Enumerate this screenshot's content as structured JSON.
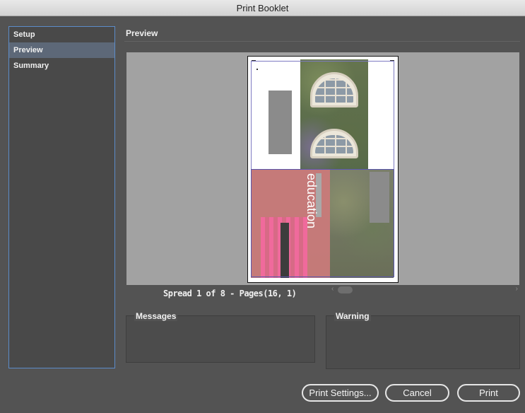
{
  "window": {
    "title": "Print Booklet"
  },
  "sidebar": {
    "items": [
      {
        "label": "Setup",
        "selected": false
      },
      {
        "label": "Preview",
        "selected": true
      },
      {
        "label": "Summary",
        "selected": false
      }
    ]
  },
  "main": {
    "section_title": "Preview",
    "preview": {
      "page_text": "education",
      "spread_label": "Spread 1 of 8 - Pages(16, 1)"
    },
    "messages": {
      "title": "Messages"
    },
    "warning": {
      "title": "Warning"
    }
  },
  "footer": {
    "print_settings_label": "Print Settings...",
    "cancel_label": "Cancel",
    "print_label": "Print"
  },
  "colors": {
    "selected_item": "#5d6878",
    "sidebar_border": "#5c8cc9",
    "dialog_bg": "#535353",
    "preview_bg": "#a2a2a2"
  },
  "icons": {
    "scroll_left": "chevron-left-icon",
    "scroll_right": "chevron-right-icon"
  }
}
